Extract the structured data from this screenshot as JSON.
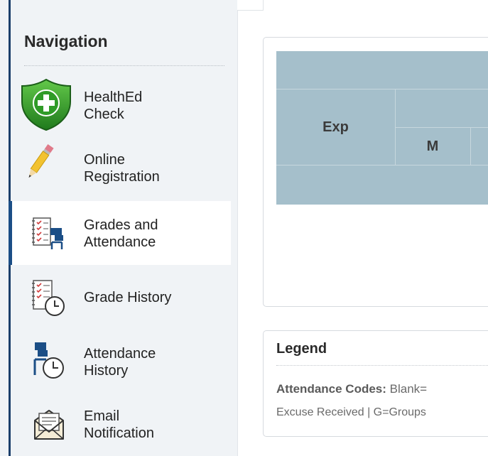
{
  "sidebar": {
    "title": "Navigation",
    "items": [
      {
        "label_line1": "HealthEd",
        "label_line2": "Check",
        "icon": "health-shield-icon"
      },
      {
        "label_line1": "Online",
        "label_line2": "Registration",
        "icon": "pencil-icon"
      },
      {
        "label_line1": "Grades and",
        "label_line2": "Attendance",
        "icon": "grades-attendance-icon",
        "active": true
      },
      {
        "label_line1": "Grade History",
        "label_line2": "",
        "icon": "grade-history-icon"
      },
      {
        "label_line1": "Attendance",
        "label_line2": "History",
        "icon": "attendance-history-icon"
      },
      {
        "label_line1": "Email",
        "label_line2": "Notification",
        "icon": "email-icon"
      }
    ]
  },
  "table": {
    "header_exp": "Exp",
    "header_m": "M"
  },
  "legend": {
    "title": "Legend",
    "attendance_label": "Attendance Codes:",
    "attendance_text": "Blank=",
    "line2": "Excuse Received | G=Groups"
  },
  "colors": {
    "accent": "#1b4e86",
    "table_header": "#a5bfcb",
    "sidebar_bg": "#f0f3f6"
  }
}
